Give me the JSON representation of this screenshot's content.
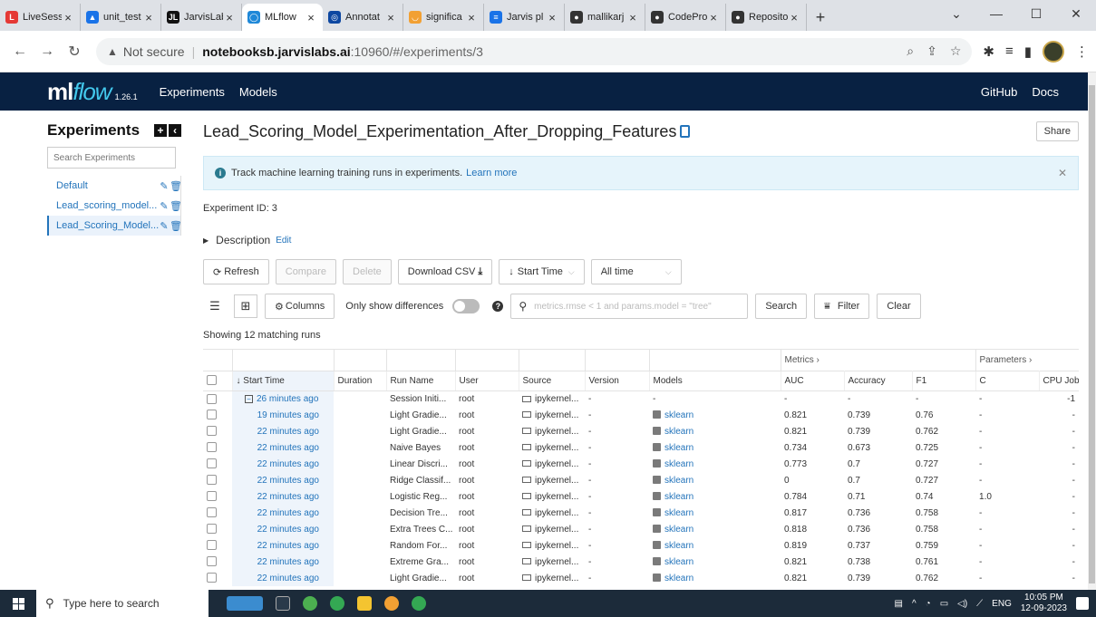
{
  "browser": {
    "tabs": [
      {
        "label": "LiveSessi",
        "color": "#e53935",
        "icon": "L"
      },
      {
        "label": "unit_test",
        "color": "#1a73e8",
        "icon": "▲"
      },
      {
        "label": "JarvisLab",
        "color": "#111111",
        "icon": "JL"
      },
      {
        "label": "MLflow",
        "color": "#1f88d8",
        "icon": "◯",
        "active": true
      },
      {
        "label": "Annotat",
        "color": "#0d47a1",
        "icon": "◎"
      },
      {
        "label": "significa",
        "color": "#f2a033",
        "icon": "◡"
      },
      {
        "label": "Jarvis pl",
        "color": "#1a73e8",
        "icon": "≡"
      },
      {
        "label": "mallikarj",
        "color": "#333333",
        "icon": "●"
      },
      {
        "label": "CodePro",
        "color": "#333333",
        "icon": "●"
      },
      {
        "label": "Reposito",
        "color": "#333333",
        "icon": "●"
      }
    ],
    "new_tab": "+",
    "url_warning": "Not secure",
    "url_host": "notebooksb.jarvislabs.ai",
    "url_path": ":10960/#/experiments/3"
  },
  "mlflow": {
    "logo_ml": "ml",
    "logo_flow": "flow",
    "version": "1.26.1",
    "nav": [
      "Experiments",
      "Models"
    ],
    "right_links": [
      "GitHub",
      "Docs"
    ]
  },
  "sidebar": {
    "title": "Experiments",
    "search_placeholder": "Search Experiments",
    "items": [
      {
        "name": "Default"
      },
      {
        "name": "Lead_scoring_model..."
      },
      {
        "name": "Lead_Scoring_Model..."
      }
    ]
  },
  "main": {
    "title": "Lead_Scoring_Model_Experimentation_After_Dropping_Features",
    "share": "Share",
    "banner_text": "Track machine learning training runs in experiments.",
    "banner_link": "Learn more",
    "experiment_id": "Experiment ID: 3",
    "description": "Description",
    "edit": "Edit",
    "toolbar": {
      "refresh": "Refresh",
      "compare": "Compare",
      "delete": "Delete",
      "download": "Download CSV",
      "sort": "Start Time",
      "time": "All time",
      "columns": "Columns",
      "only_diff": "Only show differences",
      "search_placeholder": "metrics.rmse < 1 and params.model = \"tree\"",
      "search": "Search",
      "filter": "Filter",
      "clear": "Clear"
    },
    "showing": "Showing 12 matching runs"
  },
  "table": {
    "groups": {
      "metrics": "Metrics",
      "parameters": "Parameters"
    },
    "headers": [
      "Start Time",
      "Duration",
      "Run Name",
      "User",
      "Source",
      "Version",
      "Models",
      "AUC",
      "Accuracy",
      "F1",
      "C",
      "CPU Jobs"
    ],
    "rows": [
      {
        "time": "26 minutes ago",
        "run": "Session Initi...",
        "user": "root",
        "source": "ipykernel...",
        "version": "-",
        "model": "-",
        "auc": "-",
        "acc": "-",
        "f1": "-",
        "c": "-",
        "cpu": "-1",
        "parent": true
      },
      {
        "time": "19 minutes ago",
        "run": "Light Gradie...",
        "user": "root",
        "source": "ipykernel...",
        "version": "-",
        "model": "sklearn",
        "auc": "0.821",
        "acc": "0.739",
        "f1": "0.76",
        "c": "-",
        "cpu": "-"
      },
      {
        "time": "22 minutes ago",
        "run": "Light Gradie...",
        "user": "root",
        "source": "ipykernel...",
        "version": "-",
        "model": "sklearn",
        "auc": "0.821",
        "acc": "0.739",
        "f1": "0.762",
        "c": "-",
        "cpu": "-"
      },
      {
        "time": "22 minutes ago",
        "run": "Naive Bayes",
        "user": "root",
        "source": "ipykernel...",
        "version": "-",
        "model": "sklearn",
        "auc": "0.734",
        "acc": "0.673",
        "f1": "0.725",
        "c": "-",
        "cpu": "-"
      },
      {
        "time": "22 minutes ago",
        "run": "Linear Discri...",
        "user": "root",
        "source": "ipykernel...",
        "version": "-",
        "model": "sklearn",
        "auc": "0.773",
        "acc": "0.7",
        "f1": "0.727",
        "c": "-",
        "cpu": "-"
      },
      {
        "time": "22 minutes ago",
        "run": "Ridge Classif...",
        "user": "root",
        "source": "ipykernel...",
        "version": "-",
        "model": "sklearn",
        "auc": "0",
        "acc": "0.7",
        "f1": "0.727",
        "c": "-",
        "cpu": "-"
      },
      {
        "time": "22 minutes ago",
        "run": "Logistic Reg...",
        "user": "root",
        "source": "ipykernel...",
        "version": "-",
        "model": "sklearn",
        "auc": "0.784",
        "acc": "0.71",
        "f1": "0.74",
        "c": "1.0",
        "cpu": "-"
      },
      {
        "time": "22 minutes ago",
        "run": "Decision Tre...",
        "user": "root",
        "source": "ipykernel...",
        "version": "-",
        "model": "sklearn",
        "auc": "0.817",
        "acc": "0.736",
        "f1": "0.758",
        "c": "-",
        "cpu": "-"
      },
      {
        "time": "22 minutes ago",
        "run": "Extra Trees C...",
        "user": "root",
        "source": "ipykernel...",
        "version": "-",
        "model": "sklearn",
        "auc": "0.818",
        "acc": "0.736",
        "f1": "0.758",
        "c": "-",
        "cpu": "-"
      },
      {
        "time": "22 minutes ago",
        "run": "Random For...",
        "user": "root",
        "source": "ipykernel...",
        "version": "-",
        "model": "sklearn",
        "auc": "0.819",
        "acc": "0.737",
        "f1": "0.759",
        "c": "-",
        "cpu": "-"
      },
      {
        "time": "22 minutes ago",
        "run": "Extreme Gra...",
        "user": "root",
        "source": "ipykernel...",
        "version": "-",
        "model": "sklearn",
        "auc": "0.821",
        "acc": "0.738",
        "f1": "0.761",
        "c": "-",
        "cpu": "-"
      },
      {
        "time": "22 minutes ago",
        "run": "Light Gradie...",
        "user": "root",
        "source": "ipykernel...",
        "version": "-",
        "model": "sklearn",
        "auc": "0.821",
        "acc": "0.739",
        "f1": "0.762",
        "c": "-",
        "cpu": "-"
      }
    ]
  },
  "taskbar": {
    "search": "Type here to search",
    "lang": "ENG",
    "time": "10:05 PM",
    "date": "12-09-2023"
  },
  "colors": {
    "mlflow_header": "#082142",
    "link": "#2374bb",
    "flow": "#43c9ed"
  }
}
